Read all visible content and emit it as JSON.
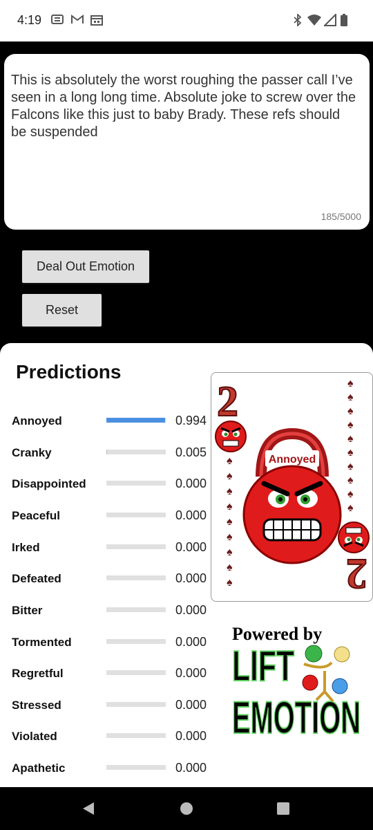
{
  "status_bar": {
    "time": "4:19"
  },
  "input": {
    "text": "This is absolutely the worst roughing the passer call I’ve seen in a long long time. Absolute joke to screw over the Falcons like this just to baby Brady. These refs should be suspended",
    "counter": "185/5000"
  },
  "buttons": {
    "deal": "Deal Out Emotion",
    "reset": "Reset"
  },
  "predictions": {
    "title": "Predictions",
    "items": [
      {
        "label": "Annoyed",
        "value": "0.994",
        "fraction": 0.994
      },
      {
        "label": "Cranky",
        "value": "0.005",
        "fraction": 0.005
      },
      {
        "label": "Disappointed",
        "value": "0.000",
        "fraction": 0
      },
      {
        "label": "Peaceful",
        "value": "0.000",
        "fraction": 0
      },
      {
        "label": "Irked",
        "value": "0.000",
        "fraction": 0
      },
      {
        "label": "Defeated",
        "value": "0.000",
        "fraction": 0
      },
      {
        "label": "Bitter",
        "value": "0.000",
        "fraction": 0
      },
      {
        "label": "Tormented",
        "value": "0.000",
        "fraction": 0
      },
      {
        "label": "Regretful",
        "value": "0.000",
        "fraction": 0
      },
      {
        "label": "Stressed",
        "value": "0.000",
        "fraction": 0
      },
      {
        "label": "Violated",
        "value": "0.000",
        "fraction": 0
      },
      {
        "label": "Apathetic",
        "value": "0.000",
        "fraction": 0
      }
    ]
  },
  "card": {
    "rank": "2",
    "emotion": "Annoyed",
    "suit": "spades"
  },
  "logo": {
    "powered_by": "Powered by",
    "line1": "LIFT",
    "line2": "EMOTION"
  },
  "colors": {
    "bar_fill": "#4a90e2",
    "card_red": "#c0392b",
    "suit_dark": "#6b1a1a"
  }
}
